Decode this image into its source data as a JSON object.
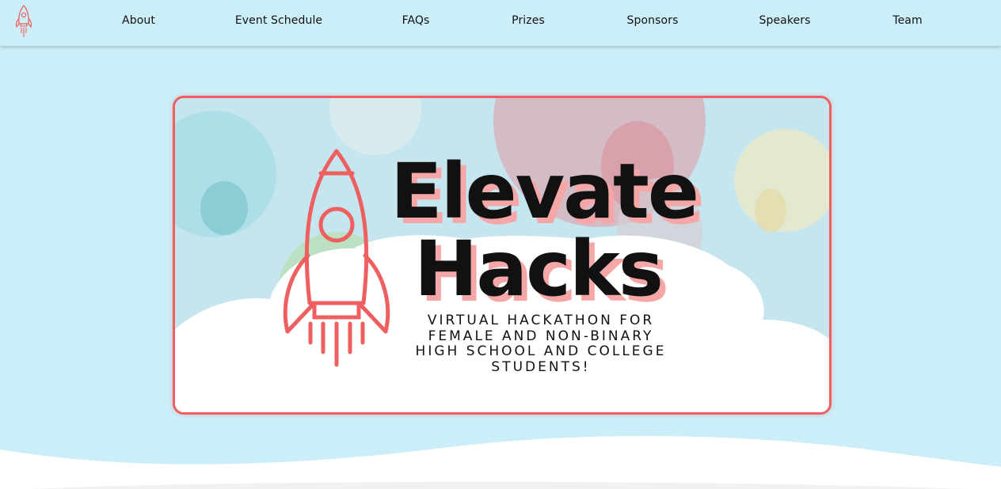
{
  "nav": {
    "logo_icon": "rocket-icon",
    "items": [
      {
        "label": "About"
      },
      {
        "label": "Event Schedule"
      },
      {
        "label": "FAQs"
      },
      {
        "label": "Prizes"
      },
      {
        "label": "Sponsors"
      },
      {
        "label": "Speakers"
      },
      {
        "label": "Team"
      }
    ]
  },
  "hero": {
    "title_line1": "Elevate",
    "title_line2": "Hacks",
    "subtitle_lines": [
      "VIRTUAL HACKATHON FOR",
      "FEMALE AND NON-BINARY",
      "HIGH SCHOOL AND COLLEGE",
      "STUDENTS!"
    ],
    "rocket_icon": "rocket-icon"
  },
  "colors": {
    "background": "#cbeef8",
    "accent": "#ef5f5f",
    "title_shadow": "#f5a6a6",
    "text": "#111111"
  }
}
